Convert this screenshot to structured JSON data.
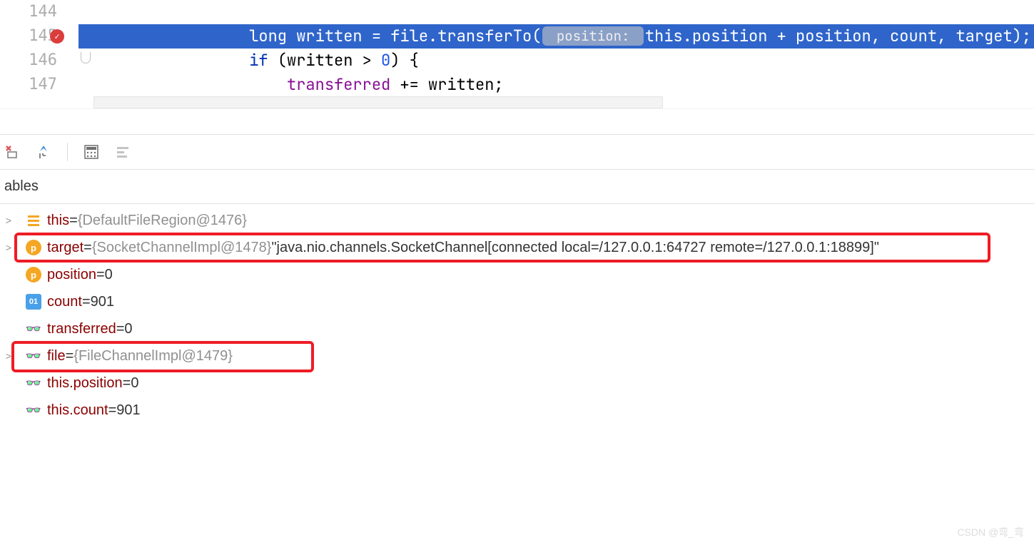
{
  "editor": {
    "lines": [
      {
        "num": "144",
        "text": ""
      },
      {
        "num": "145",
        "prefix": "                ",
        "kw": "long",
        "rest1": " written = file.transferTo(",
        "hint": " position: ",
        "kw2": "this",
        "rest2": ".position + position, count, target);   ",
        "trail": "count"
      },
      {
        "num": "146",
        "prefix": "                ",
        "kw": "if",
        "rest": " (written > ",
        "num_lit": "0",
        "rest2": ") {"
      },
      {
        "num": "147",
        "prefix": "                    ",
        "field": "transferred",
        "rest": " += written;"
      }
    ]
  },
  "panel_title": "ables",
  "variables": [
    {
      "icon": "this",
      "expandable": true,
      "name": "this",
      "eq": " = ",
      "obj": "{DefaultFileRegion@1476}",
      "val": ""
    },
    {
      "icon": "p",
      "expandable": true,
      "name": "target",
      "eq": " = ",
      "obj": "{SocketChannelImpl@1478} ",
      "val": "\"java.nio.channels.SocketChannel[connected local=/127.0.0.1:64727 remote=/127.0.0.1:18899]\""
    },
    {
      "icon": "p",
      "expandable": false,
      "name": "position",
      "eq": " = ",
      "obj": "",
      "val": "0"
    },
    {
      "icon": "01",
      "expandable": false,
      "name": "count",
      "eq": " = ",
      "obj": "",
      "val": "901"
    },
    {
      "icon": "glasses",
      "expandable": false,
      "name": "transferred",
      "eq": " = ",
      "obj": "",
      "val": "0"
    },
    {
      "icon": "glasses",
      "expandable": true,
      "name": "file",
      "eq": " = ",
      "obj": "{FileChannelImpl@1479}",
      "val": ""
    },
    {
      "icon": "glasses",
      "expandable": false,
      "name": "this.position",
      "eq": " = ",
      "obj": "",
      "val": "0"
    },
    {
      "icon": "glasses",
      "expandable": false,
      "name": "this.count",
      "eq": " = ",
      "obj": "",
      "val": "901"
    }
  ],
  "watermark": "CSDN @弯_弯"
}
